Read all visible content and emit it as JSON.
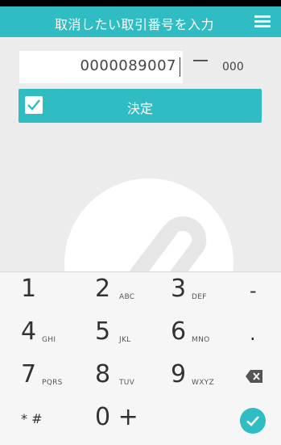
{
  "header": {
    "title": "取消したい取引番号を入力",
    "menu_icon": "menu-icon"
  },
  "form": {
    "number_value": "0000089007",
    "separator": "—",
    "suffix_value": "000"
  },
  "confirm": {
    "label": "決定",
    "checkbox_icon": "check-icon",
    "checked": true
  },
  "keypad": {
    "keys": [
      {
        "digit": "1",
        "letters": ""
      },
      {
        "digit": "2",
        "letters": "ABC"
      },
      {
        "digit": "3",
        "letters": "DEF"
      },
      {
        "digit": "4",
        "letters": "GHI"
      },
      {
        "digit": "5",
        "letters": "JKL"
      },
      {
        "digit": "6",
        "letters": "MNO"
      },
      {
        "digit": "7",
        "letters": "PQRS"
      },
      {
        "digit": "8",
        "letters": "TUV"
      },
      {
        "digit": "9",
        "letters": "WXYZ"
      },
      {
        "digit": "* #",
        "letters": ""
      },
      {
        "digit": "0 +",
        "letters": ""
      }
    ],
    "side_keys": [
      "-",
      ".",
      "backspace-icon",
      "done-check-icon"
    ]
  },
  "colors": {
    "accent": "#2fbcc2",
    "background": "#ececec",
    "keypad_background": "#f6f6f6"
  }
}
